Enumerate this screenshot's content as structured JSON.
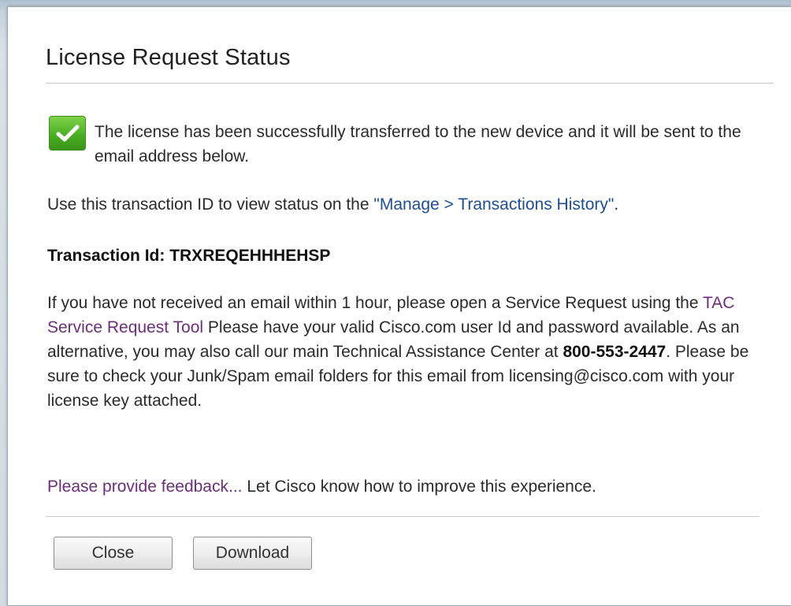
{
  "dialog": {
    "title": "License Request Status"
  },
  "success": {
    "icon": "checkmark-icon",
    "message": "The license has been successfully transferred to the new device and it will be sent to the email address below."
  },
  "transaction": {
    "intro": "Use this transaction ID to view status on the ",
    "link_label": "\"Manage > Transactions History\"",
    "after_link": ".",
    "id_label": "Transaction Id: TRXREQEHHHEHSP"
  },
  "help": {
    "part1": "If you have not received an email within 1 hour, please open a Service Request using the ",
    "tac_link": "TAC Service Request Tool",
    "part2": " Please have your valid Cisco.com user Id and password available. As an alternative, you may also call our main Technical Assistance Center at ",
    "phone": "800-553-2447",
    "part3": ". Please be sure to check your Junk/Spam email folders for this email from licensing@cisco.com with your license key attached."
  },
  "feedback": {
    "link_label": "Please provide feedback...",
    "text": " Let Cisco know how to improve this experience."
  },
  "buttons": {
    "close_label": "Close",
    "download_label": "Download"
  },
  "colors": {
    "link_blue": "#1f4e8c",
    "link_purple": "#6b2f78",
    "success_green": "#4cae24"
  }
}
